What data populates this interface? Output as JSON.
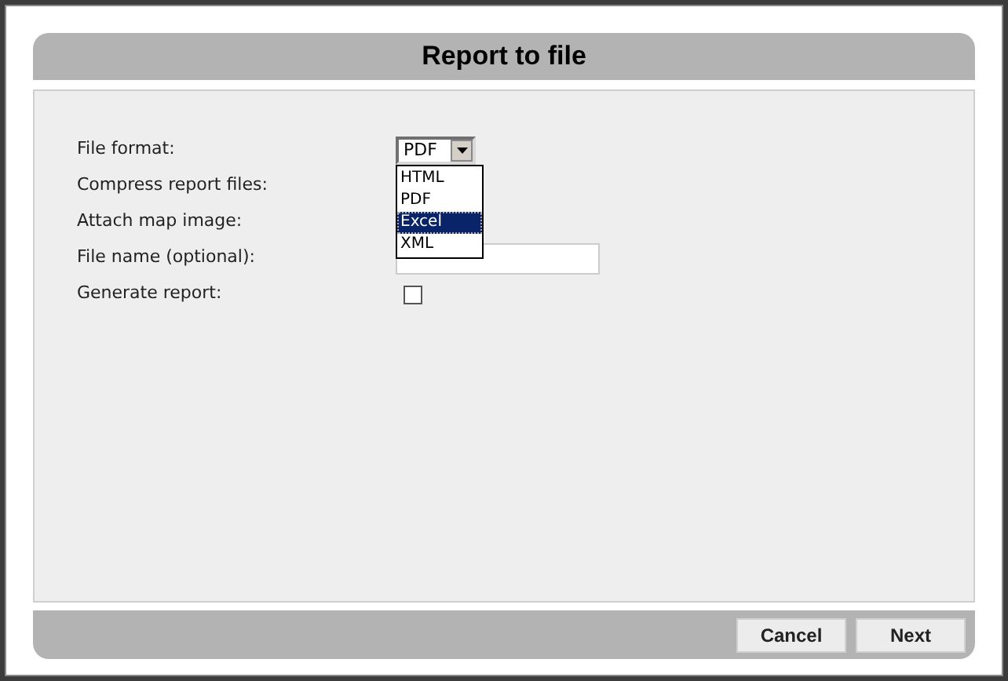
{
  "dialog": {
    "title": "Report to file"
  },
  "fields": [
    {
      "kind": "select",
      "label": "File format:",
      "value": "PDF",
      "open": true,
      "options": [
        {
          "label": "HTML",
          "highlighted": false
        },
        {
          "label": "PDF",
          "highlighted": false
        },
        {
          "label": "Excel",
          "highlighted": true
        },
        {
          "label": "XML",
          "highlighted": false
        }
      ]
    },
    {
      "kind": "label",
      "label": "Compress report files:"
    },
    {
      "kind": "label",
      "label": "Attach map image:"
    },
    {
      "kind": "text",
      "label": "File name (optional):"
    },
    {
      "kind": "checkbox",
      "label": "Generate report:",
      "checked": false
    }
  ],
  "buttons": [
    "Cancel",
    "Next"
  ]
}
